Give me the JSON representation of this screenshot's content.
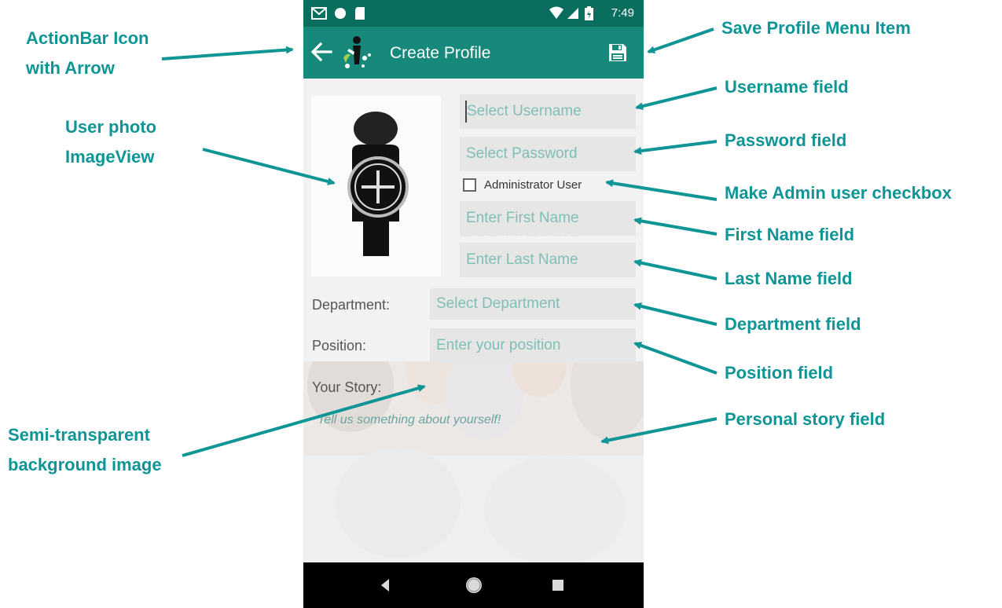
{
  "status_bar": {
    "icons": [
      "gmail-icon",
      "circle-icon",
      "sd-card-icon",
      "wifi-icon",
      "signal-icon",
      "battery-charging-icon"
    ],
    "time": "7:49"
  },
  "action_bar": {
    "title": "Create Profile",
    "back_icon": "arrow-left-icon",
    "logo_icon": "app-logo-icon",
    "save_icon": "floppy-disk-icon"
  },
  "form": {
    "username_placeholder": "Select Username",
    "password_placeholder": "Select Password",
    "admin_checkbox_label": "Administrator User",
    "admin_checked": false,
    "first_name_placeholder": "Enter First Name",
    "last_name_placeholder": "Enter Last Name",
    "department_label": "Department:",
    "department_placeholder": "Select Department",
    "position_label": "Position:",
    "position_placeholder": "Enter your position",
    "story_label": "Your Story:",
    "story_placeholder": "Tell us something about yourself!"
  },
  "background": {
    "watermark_text": "Rewards"
  },
  "nav_bar": {
    "icons": [
      "back-triangle-icon",
      "home-circle-icon",
      "recents-square-icon"
    ]
  },
  "annotations": {
    "actionbar_icon": [
      "ActionBar Icon",
      "with Arrow"
    ],
    "user_photo": [
      "User photo",
      "ImageView"
    ],
    "background_image": [
      "Semi-transparent",
      "background image"
    ],
    "save_menu": "Save Profile Menu Item",
    "username": "Username field",
    "password": "Password field",
    "admin_checkbox": "Make Admin user checkbox",
    "first_name": "First Name field",
    "last_name": "Last Name field",
    "department": "Department field",
    "position": "Position field",
    "story": "Personal story field"
  },
  "colors": {
    "annotation": "#0f9595",
    "status_bar": "#0a6e5e",
    "action_bar": "#16897a",
    "placeholder": "#7fbfb5"
  }
}
